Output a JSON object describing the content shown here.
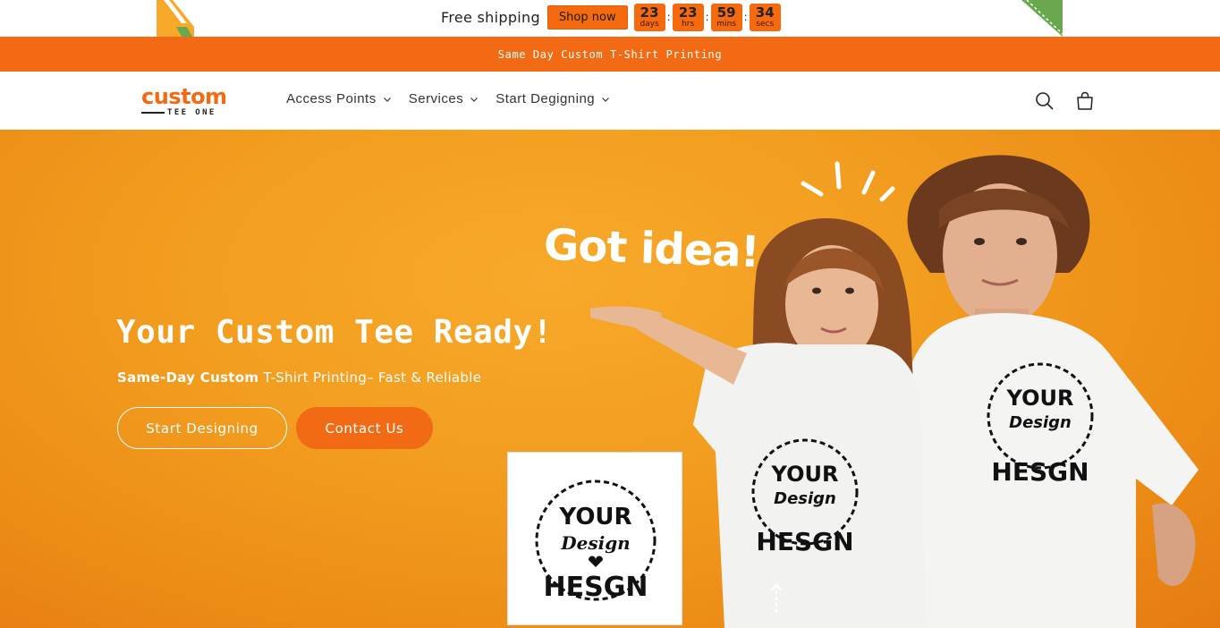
{
  "promo": {
    "text": "Free shipping",
    "shop_label": "Shop now",
    "countdown": [
      {
        "num": "23",
        "unit": "days"
      },
      {
        "num": "23",
        "unit": "hrs"
      },
      {
        "num": "59",
        "unit": "mins"
      },
      {
        "num": "34",
        "unit": "secs"
      }
    ],
    "separator": ":"
  },
  "announcement": "Same Day Custom T-Shirt Printing",
  "logo": {
    "main": "custom",
    "sub": "TEE ONE"
  },
  "nav": [
    {
      "label": "Access Points"
    },
    {
      "label": "Services"
    },
    {
      "label": "Start Degigning"
    }
  ],
  "hero": {
    "title": "Your Custom Tee Ready!",
    "subtitle_bold": "Same-Day Custom",
    "subtitle_rest": " T-Shirt Printing– Fast & Reliable",
    "primary_btn": "Start Designing",
    "secondary_btn": "Contact Us",
    "handwritten": "Got idea!",
    "design_lines": [
      "YOUR",
      "Design",
      "HESGN"
    ]
  },
  "colors": {
    "accent": "#f26a13",
    "hero_bg": "#f29d1f"
  }
}
